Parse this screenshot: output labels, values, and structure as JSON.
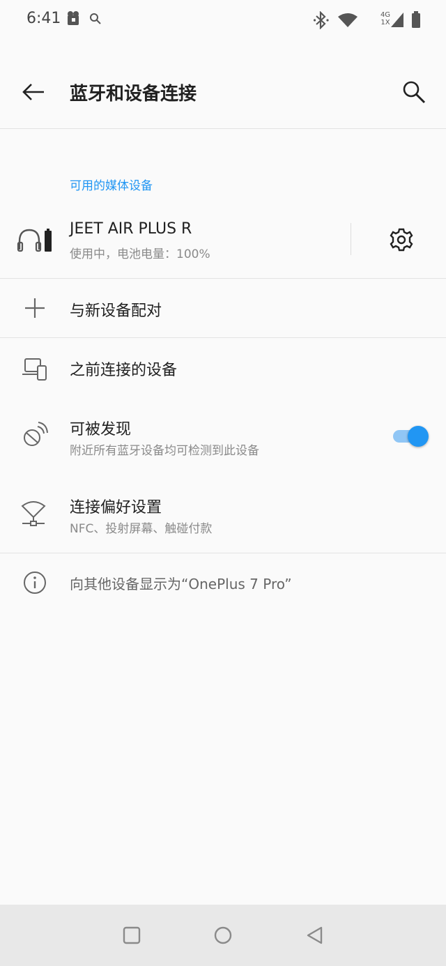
{
  "status_bar": {
    "time": "6:41",
    "icons": [
      "app-notification-icon",
      "search-icon",
      "bluetooth-icon",
      "wifi-icon",
      "signal-4g-icon",
      "battery-icon"
    ],
    "network_label_top": "4G",
    "network_label_bottom": "1X"
  },
  "app_bar": {
    "title": "蓝牙和设备连接",
    "back_icon": "arrow-left-icon",
    "search_icon": "search-icon"
  },
  "available_media": {
    "section_title": "可用的媒体设备",
    "device": {
      "name": "JEET AIR PLUS R",
      "status": "使用中，电池电量：100%",
      "icon": "headphones-icon",
      "settings_icon": "gear-icon"
    }
  },
  "items": {
    "pair_new": {
      "title": "与新设备配对",
      "icon": "plus-icon"
    },
    "previous": {
      "title": "之前连接的设备",
      "icon": "devices-icon"
    },
    "discoverable": {
      "title": "可被发现",
      "subtitle": "附近所有蓝牙设备均可检测到此设备",
      "icon": "bluetooth-searching-icon",
      "enabled": true
    },
    "preferences": {
      "title": "连接偏好设置",
      "subtitle": "NFC、投射屏幕、触碰付款",
      "icon": "connection-prefs-icon"
    }
  },
  "footer_info": {
    "text": "向其他设备显示为“OnePlus 7 Pro”",
    "icon": "info-icon"
  },
  "nav_bar": {
    "icons": [
      "recents-square-icon",
      "home-circle-icon",
      "back-triangle-icon"
    ]
  },
  "colors": {
    "accent": "#2196f3",
    "toggle_track": "#90c6f5",
    "background": "#fafafa",
    "navbar": "#e8e8e8"
  }
}
